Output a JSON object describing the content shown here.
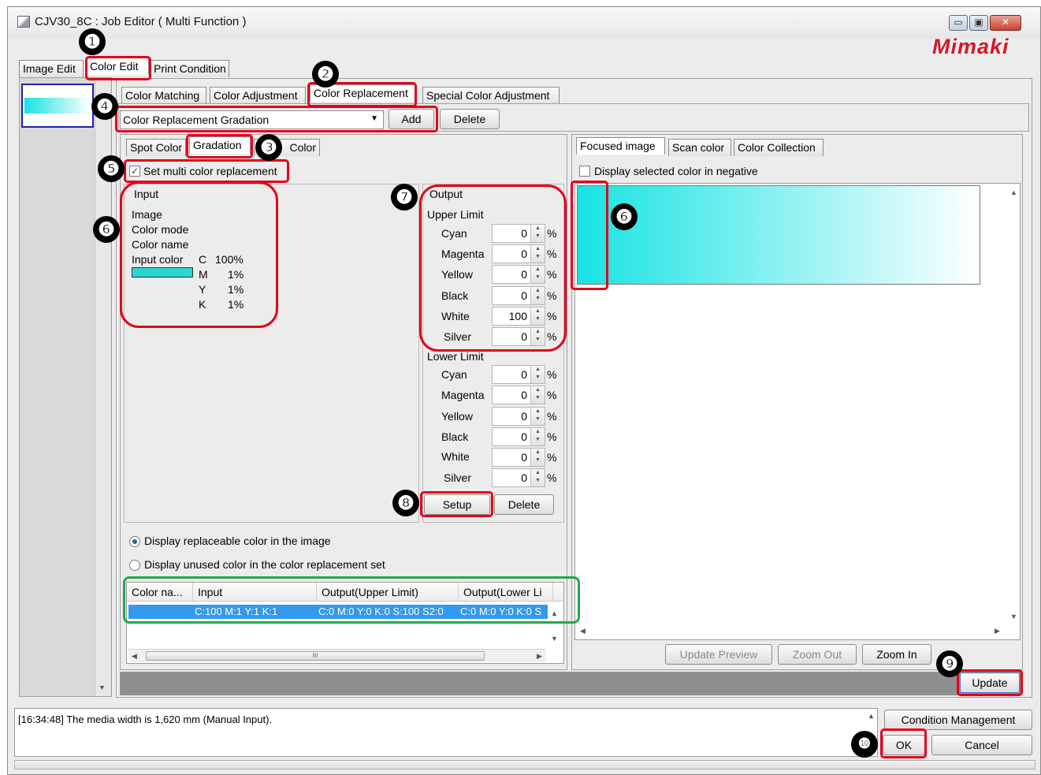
{
  "window": {
    "title": "CJV30_8C : Job Editor ( Multi Function )",
    "logo": "Mimaki",
    "controls": [
      "minimize-icon",
      "maximize-icon",
      "close-icon"
    ]
  },
  "main_tabs": [
    {
      "label": "Image Edit",
      "selected": false
    },
    {
      "label": "Color Edit",
      "selected": true
    },
    {
      "label": "Print Condition",
      "selected": false
    }
  ],
  "sub_tabs": [
    {
      "label": "Color Matching",
      "selected": false
    },
    {
      "label": "Color Adjustment",
      "selected": false
    },
    {
      "label": "Color Replacement",
      "selected": true
    },
    {
      "label": "Special Color Adjustment",
      "selected": false
    }
  ],
  "replacement_set": {
    "selected": "Color Replacement Gradation",
    "add_label": "Add",
    "delete_label": "Delete"
  },
  "mode_tabs": [
    {
      "label": "Spot Color",
      "selected": false
    },
    {
      "label": "Gradation",
      "selected": true
    },
    {
      "label": "Color",
      "selected": false
    }
  ],
  "multi_replace": {
    "label": "Set multi color replacement",
    "checked": true
  },
  "input": {
    "group_label": "Input",
    "image_label": "Image",
    "color_mode_label": "Color mode",
    "color_name_label": "Color name",
    "input_color_label": "Input color",
    "swatch_color": "#29d6d6",
    "values": [
      {
        "ch": "C",
        "val": "100%"
      },
      {
        "ch": "M",
        "val": "1%"
      },
      {
        "ch": "Y",
        "val": "1%"
      },
      {
        "ch": "K",
        "val": "1%"
      }
    ]
  },
  "output": {
    "group_label": "Output",
    "upper_label": "Upper Limit",
    "lower_label": "Lower Limit",
    "unit": "%",
    "upper": [
      {
        "name": "Cyan",
        "value": "0"
      },
      {
        "name": "Magenta",
        "value": "0"
      },
      {
        "name": "Yellow",
        "value": "0"
      },
      {
        "name": "Black",
        "value": "0"
      },
      {
        "name": "White",
        "value": "100"
      },
      {
        "name": "Silver",
        "value": "0"
      }
    ],
    "lower": [
      {
        "name": "Cyan",
        "value": "0"
      },
      {
        "name": "Magenta",
        "value": "0"
      },
      {
        "name": "Yellow",
        "value": "0"
      },
      {
        "name": "Black",
        "value": "0"
      },
      {
        "name": "White",
        "value": "0"
      },
      {
        "name": "Silver",
        "value": "0"
      }
    ],
    "setup_label": "Setup",
    "delete_label": "Delete"
  },
  "display_options": [
    {
      "label": "Display replaceable color in the image",
      "selected": true
    },
    {
      "label": "Display unused color in the color replacement set",
      "selected": false
    }
  ],
  "table": {
    "headers": [
      "Color na...",
      "Input",
      "Output(Upper Limit)",
      "Output(Lower Li"
    ],
    "rows": [
      [
        "",
        "C:100 M:1 Y:1 K:1",
        "C:0 M:0 Y:0 K:0 S:100 S2:0",
        "C:0 M:0 Y:0 K:0 S"
      ]
    ],
    "hscroll_grip": "III"
  },
  "preview": {
    "tabs": [
      {
        "label": "Focused image",
        "selected": true
      },
      {
        "label": "Scan color",
        "selected": false
      },
      {
        "label": "Color Collection",
        "selected": false
      }
    ],
    "negative_label": "Display selected color in negative",
    "negative_checked": false,
    "gradient_from": "#18e3e3",
    "gradient_to": "#ffffff",
    "update_preview_label": "Update Preview",
    "zoom_out_label": "Zoom Out",
    "zoom_in_label": "Zoom In"
  },
  "update_label": "Update",
  "log": {
    "message": "[16:34:48] The media width is 1,620 mm (Manual Input)."
  },
  "buttons": {
    "condition_management": "Condition Management",
    "ok": "OK",
    "cancel": "Cancel"
  },
  "markers": {
    "m1": "❶",
    "m2": "❷",
    "m3": "❸",
    "m4": "❹",
    "m5": "❺",
    "m6": "❻",
    "m7": "❼",
    "m8": "❽",
    "m9": "❾",
    "m10": "❿"
  }
}
